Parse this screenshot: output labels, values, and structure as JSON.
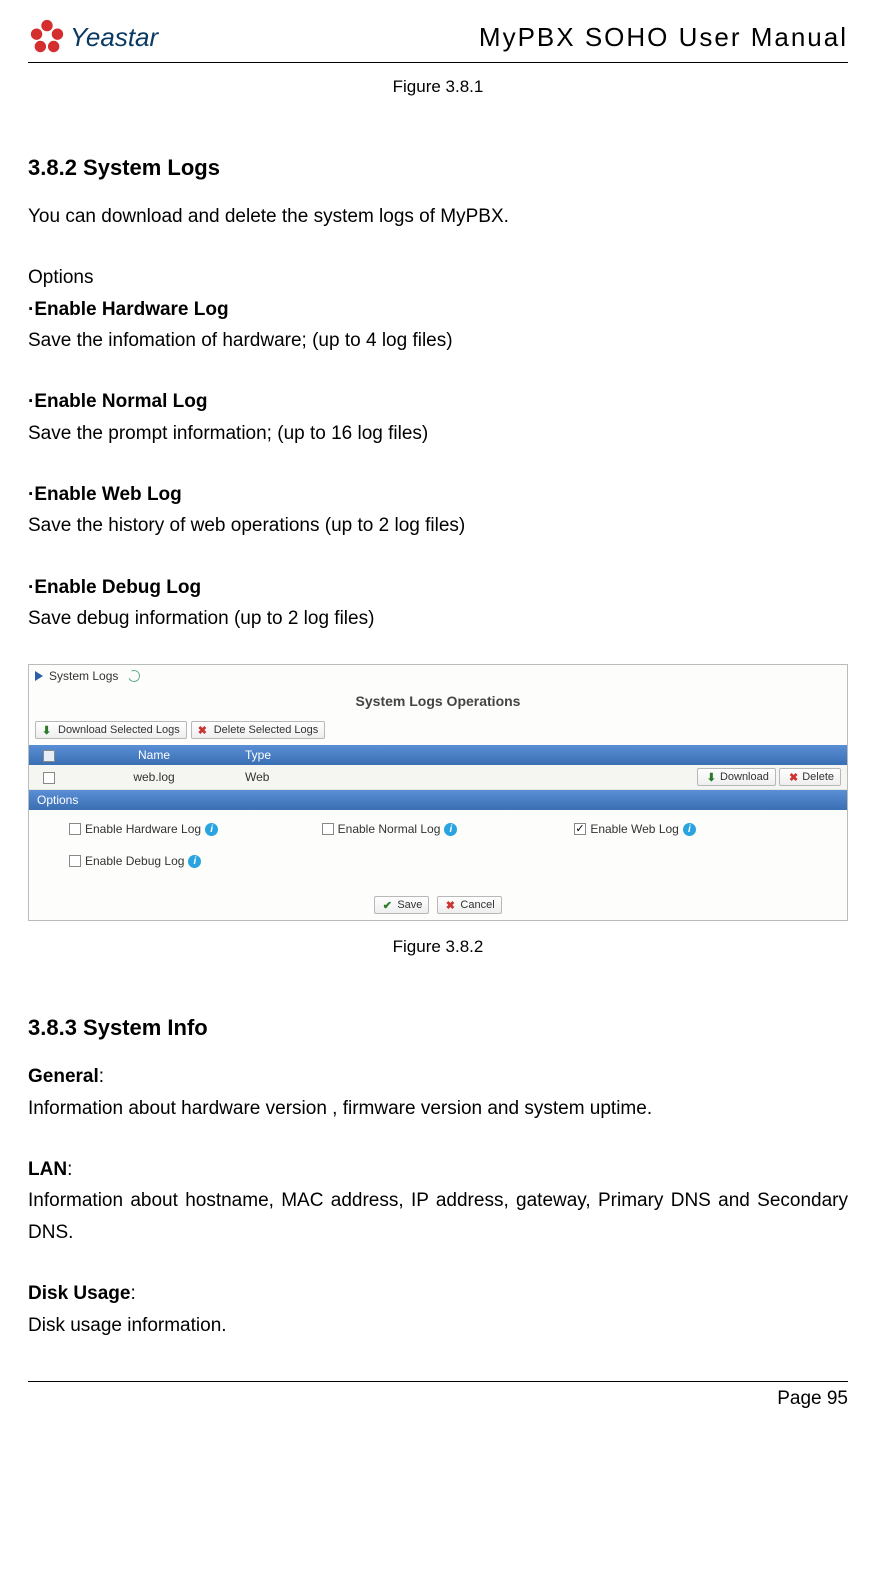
{
  "header": {
    "brand": "Yeastar",
    "doc_title": "MyPBX SOHO User Manual"
  },
  "fig1_caption": "Figure 3.8.1",
  "section1": {
    "heading": "3.8.2 System Logs",
    "intro": "You can download and delete the system logs of MyPBX.",
    "options_label": "Options",
    "items": [
      {
        "title": "·Enable Hardware Log",
        "desc": "Save the infomation of hardware; (up to 4 log files)"
      },
      {
        "title": "·Enable Normal Log",
        "desc": "Save the prompt information; (up to 16 log files)"
      },
      {
        "title": "·Enable Web Log",
        "desc": "Save the history of web operations (up to 2 log files)"
      },
      {
        "title": "·Enable Debug Log",
        "desc": "Save debug information (up to 2 log files)"
      }
    ]
  },
  "screenshot": {
    "breadcrumb": "System Logs",
    "panel_title": "System Logs Operations",
    "btn_dl_sel": "Download Selected Logs",
    "btn_del_sel": "Delete Selected Logs",
    "col_name": "Name",
    "col_type": "Type",
    "row_name": "web.log",
    "row_type": "Web",
    "btn_download": "Download",
    "btn_delete": "Delete",
    "options_bar": "Options",
    "opt_hw": "Enable Hardware Log",
    "opt_normal": "Enable Normal Log",
    "opt_web": "Enable Web Log",
    "opt_debug": "Enable Debug Log",
    "btn_save": "Save",
    "btn_cancel": "Cancel"
  },
  "fig2_caption": "Figure 3.8.2",
  "section2": {
    "heading": "3.8.3 System Info",
    "general_h": "General",
    "general_t": "Information about hardware version , firmware version and system uptime.",
    "lan_h": "LAN",
    "lan_t": "Information about hostname, MAC address, IP address, gateway, Primary DNS and Secondary DNS.",
    "disk_h": "Disk Usage",
    "disk_t": "Disk usage information."
  },
  "footer": "Page 95"
}
